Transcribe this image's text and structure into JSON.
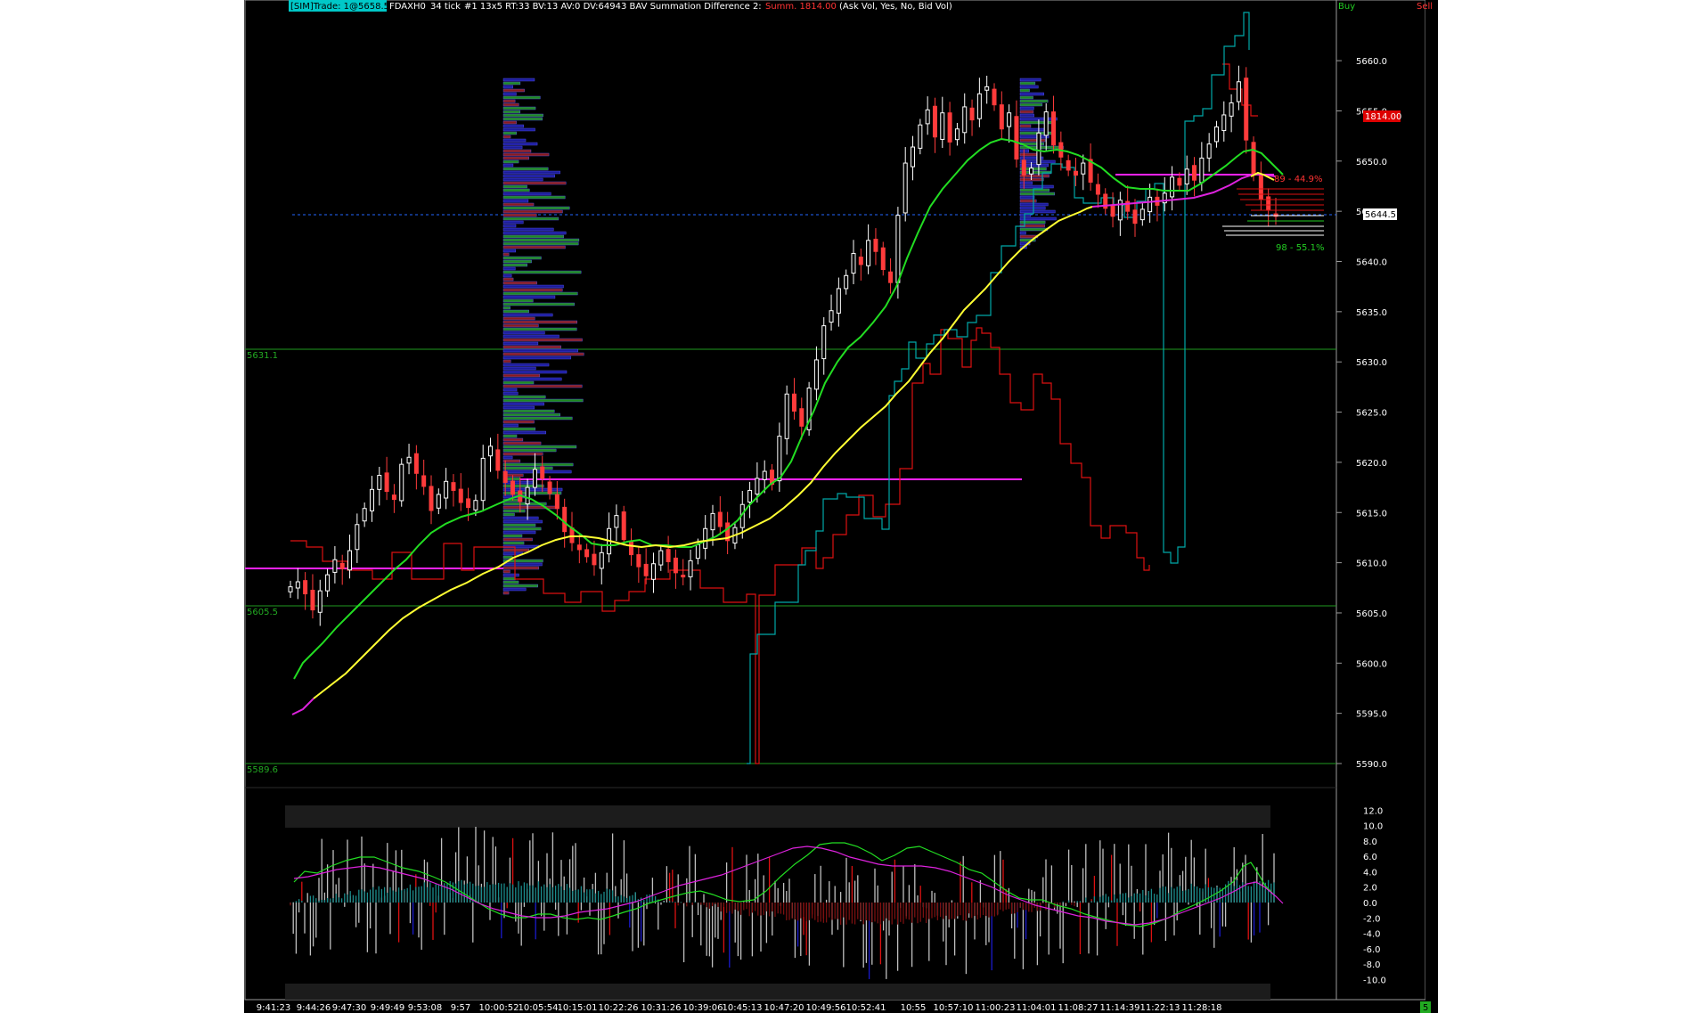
{
  "header": {
    "sim_badge": "[SIM]Trade: 1@5658.5",
    "symbol": "FDAXH0",
    "bar_type": "34 tick",
    "info": "#1 13x5 RT:33 BV:13 AV:0 DV:64943 BAV Summation Difference 2:",
    "summ": "Summ. 1814.00",
    "params": "(Ask Vol, Yes, No, Bid Vol)",
    "buy_label": "Buy",
    "sell_label": "Sell"
  },
  "colors": {
    "background": "#000000",
    "up_bar": "#ffffff",
    "down_bar": "#ff3b3b",
    "ma_fast": "#22dd22",
    "ma_slow": "#ffff33",
    "ma_tail": "#dd22dd",
    "pivot": "#ff22ff",
    "level_line": "#22aa22",
    "bid_line": "#2266ff",
    "profile_buy": "#1f8a1f",
    "profile_sell": "#1c1c9a",
    "profile_mid": "#8a1c1c",
    "cyan_line": "#00c8c8",
    "red_line": "#dd1111",
    "sim_badge": "#00c8c8",
    "summ_text": "#ff3333",
    "price_marker": "#dd0000",
    "indicator_badge": "#22aa22"
  },
  "price_axis": {
    "labels": [
      "5660.0",
      "5655.0",
      "5650.0",
      "5645.0",
      "5640.0",
      "5635.0",
      "5630.0",
      "5625.0",
      "5620.0",
      "5615.0",
      "5610.0",
      "5605.0",
      "5600.0",
      "5595.0",
      "5590.0"
    ],
    "current_price_marker": "5644.5",
    "summ_marker": "1814.00",
    "fib_upper": "89 - 44.9%",
    "fib_lower": "98 - 55.1%"
  },
  "levels": {
    "high_line": "5631.1",
    "mid_line": "5605.5",
    "low_line": "5589.6"
  },
  "indicator_axis": {
    "labels": [
      "12.0",
      "10.0",
      "8.0",
      "6.0",
      "4.0",
      "2.0",
      "0.0",
      "-2.0",
      "-4.0",
      "-6.0",
      "-8.0",
      "-10.0"
    ],
    "badge": "5"
  },
  "time_axis": {
    "labels": [
      "9:41:23",
      "9:44:26",
      "9:47:30",
      "9:49:49",
      "9:53:08",
      "9:57",
      "10:00:52",
      "10:05:54",
      "10:15:01",
      "10:22:26",
      "10:31:26",
      "10:39:06",
      "10:45:13",
      "10:47:20",
      "10:49:56",
      "10:52:41",
      "10:55",
      "10:57:10",
      "11:00:23",
      "11:04:01",
      "11:08:27",
      "11:14:39",
      "11:22:13",
      "11:28:18"
    ]
  },
  "chart_data": {
    "type": "candlestick",
    "symbol": "FDAXH0",
    "ylim": [
      5588,
      5665
    ],
    "indicator_ylim": [
      -11,
      12
    ],
    "closes": [
      5607.6,
      5608.1,
      5606.9,
      5605.3,
      5607.2,
      5608.8,
      5610.3,
      5609.4,
      5611.2,
      5613.8,
      5615.4,
      5617.3,
      5618.7,
      5617.1,
      5616.3,
      5619.8,
      5620.5,
      5618.9,
      5617.6,
      5615.2,
      5616.8,
      5618.1,
      5617.2,
      5616.0,
      5615.5,
      5616.2,
      5620.4,
      5621.6,
      5619.2,
      5618.0,
      5616.8,
      5616.1,
      5617.5,
      5619.3,
      5618.4,
      5616.9,
      5615.4,
      5613.1,
      5612.0,
      5611.3,
      5610.6,
      5609.8,
      5611.0,
      5613.4,
      5614.7,
      5612.3,
      5610.8,
      5609.6,
      5608.7,
      5609.9,
      5611.2,
      5610.1,
      5609.0,
      5608.6,
      5610.2,
      5611.8,
      5613.4,
      5614.9,
      5613.6,
      5612.2,
      5613.5,
      5615.8,
      5617.2,
      5618.4,
      5619.1,
      5617.8,
      5622.6,
      5626.8,
      5625.1,
      5623.6,
      5627.4,
      5630.2,
      5633.6,
      5635.1,
      5637.3,
      5638.6,
      5640.8,
      5639.7,
      5642.1,
      5641.0,
      5639.2,
      5637.9,
      5644.6,
      5649.8,
      5651.4,
      5653.6,
      5655.1,
      5652.4,
      5654.8,
      5651.9,
      5653.2,
      5655.4,
      5654.1,
      5656.7,
      5657.4,
      5655.6,
      5653.2,
      5654.8,
      5650.2,
      5648.6,
      5649.3,
      5652.8,
      5654.9,
      5651.6,
      5650.4,
      5649.1,
      5648.6,
      5649.8,
      5647.9,
      5646.7,
      5645.3,
      5644.5,
      5646.1,
      5645.0,
      5643.8,
      5645.2,
      5646.4,
      5645.6,
      5646.8,
      5648.4,
      5647.6,
      5649.2,
      5648.1,
      5650.3,
      5651.7,
      5653.4,
      5654.6,
      5655.8,
      5657.9,
      5652.1,
      5648.6,
      5646.2,
      5645.1,
      5644.5
    ]
  }
}
